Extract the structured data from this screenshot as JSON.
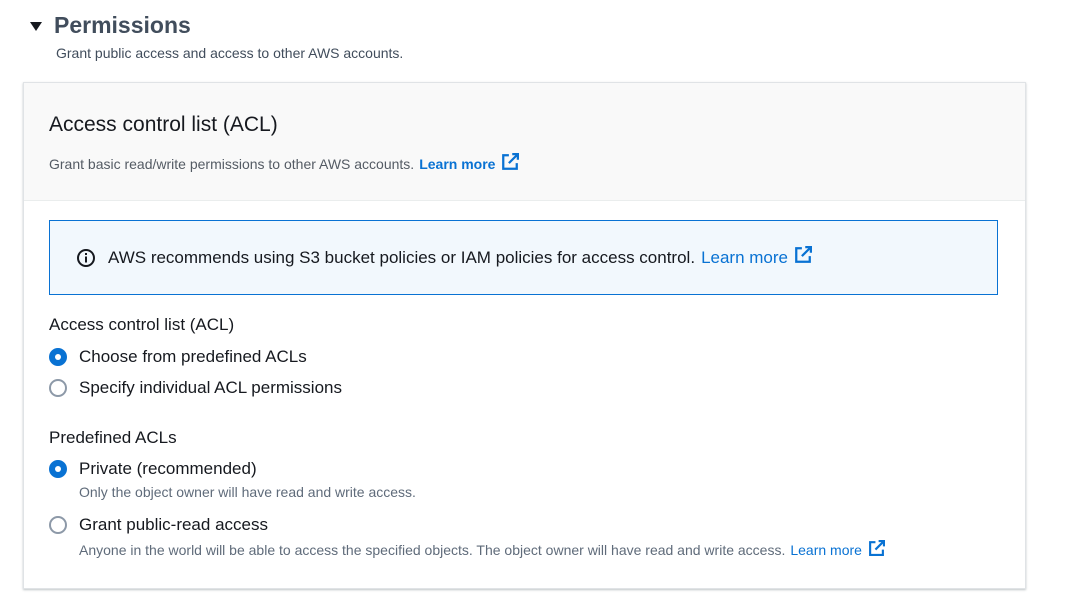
{
  "section": {
    "title": "Permissions",
    "description": "Grant public access and access to other AWS accounts."
  },
  "container": {
    "title": "Access control list (ACL)",
    "description": "Grant basic read/write permissions to other AWS accounts.",
    "learn_more": "Learn more"
  },
  "info": {
    "text": "AWS recommends using S3 bucket policies or IAM policies for access control.",
    "learn_more": "Learn more"
  },
  "acl_group": {
    "label": "Access control list (ACL)",
    "options": [
      {
        "label": "Choose from predefined ACLs",
        "checked": true
      },
      {
        "label": "Specify individual ACL permissions",
        "checked": false
      }
    ]
  },
  "predefined_group": {
    "label": "Predefined ACLs",
    "options": [
      {
        "label": "Private (recommended)",
        "description": "Only the object owner will have read and write access.",
        "checked": true
      },
      {
        "label": "Grant public-read access",
        "description": "Anyone in the world will be able to access the specified objects. The object owner will have read and write access.",
        "learn_more": "Learn more",
        "checked": false
      }
    ]
  },
  "colors": {
    "link": "#0972d3",
    "info_bg": "#f2f8fd"
  }
}
